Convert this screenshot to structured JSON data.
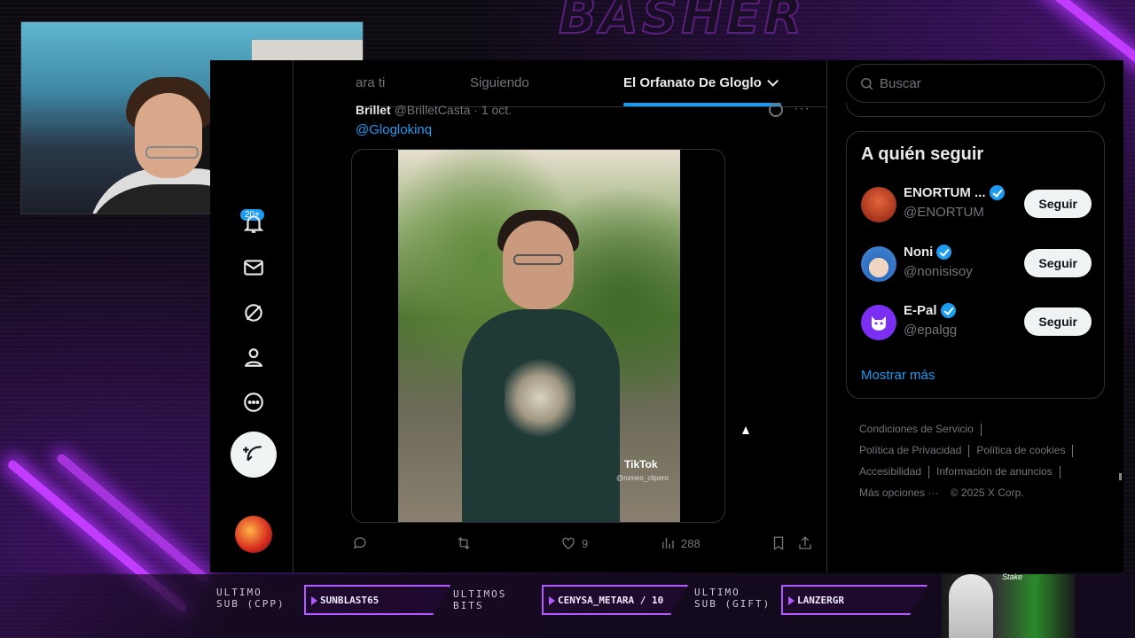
{
  "overlay": {
    "banner_text": "BASHER",
    "labels": {
      "last_sub_cpp": "ULTIMO\nSUB (CPP)",
      "last_bits": "ULTIMOS\nBITS",
      "last_sub_gift": "ULTIMO\nSUB (GIFT)"
    },
    "values": {
      "last_sub_cpp": "SUNBLAST65",
      "last_bits": "CENYSA_METARA / 10",
      "last_sub_gift": "LANZERGR"
    },
    "corner_tag": "Stake"
  },
  "nav": {
    "notifications_badge": "20+",
    "icons": [
      "bell-icon",
      "mail-icon",
      "grok-icon",
      "profile-icon",
      "more-icon"
    ]
  },
  "tabs": [
    {
      "label": "Para ti"
    },
    {
      "label": "Siguiendo"
    },
    {
      "label": "El Orfanato De Gloglo",
      "active": true
    }
  ],
  "tweet": {
    "author": "Brillet",
    "handle": "@BrilletCasta",
    "date": "· 1 oct.",
    "link_text": "@Gloglokinq",
    "video_watermark": "TikTok",
    "video_handle": "@romeo_clipero",
    "likes": "9",
    "views": "288"
  },
  "search": {
    "placeholder": "Buscar"
  },
  "who_to_follow": {
    "title": "A quién seguir",
    "accounts": [
      {
        "name": "ENORTUM ...",
        "handle": "@ENORTUM",
        "button": "Seguir",
        "avatar_color": "#b23a1c"
      },
      {
        "name": "Noni",
        "handle": "@nonisisoy",
        "button": "Seguir",
        "avatar_color": "#4a8ad8"
      },
      {
        "name": "E-Pal",
        "handle": "@epalgg",
        "button": "Seguir",
        "avatar_color": "#7b2ff2"
      }
    ],
    "show_more": "Mostrar más"
  },
  "footer": {
    "links": [
      "Condiciones de Servicio",
      "Política de Privacidad",
      "Política de cookies",
      "Accesibilidad",
      "Información de anuncios",
      "Más opciones ···"
    ],
    "copyright": "© 2025 X Corp."
  },
  "colors": {
    "accent": "#1d9bf0",
    "neon": "#c13cff",
    "background": "#000000"
  }
}
